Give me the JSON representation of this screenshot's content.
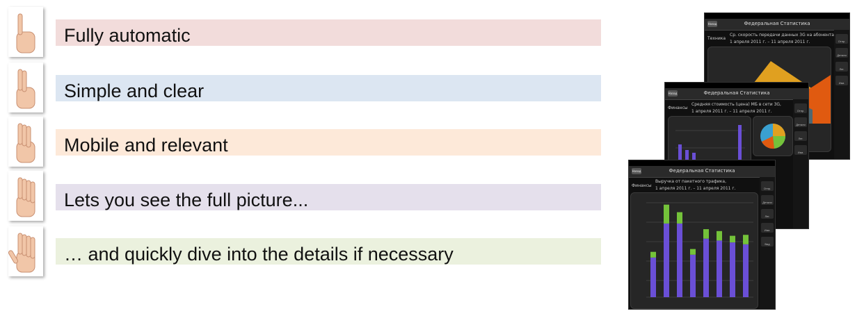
{
  "features": [
    {
      "label": "Fully automatic",
      "color": "#f2dcdb",
      "fingers": 1
    },
    {
      "label": "Simple and clear",
      "color": "#dce6f2",
      "fingers": 2
    },
    {
      "label": "Mobile and relevant",
      "color": "#fde9d9",
      "fingers": 3
    },
    {
      "label": "Lets you see the full picture...",
      "color": "#e5e0ec",
      "fingers": 4
    },
    {
      "label": "… and quickly dive into the details if necessary",
      "color": "#ebf1de",
      "fingers": 5
    }
  ],
  "screens": {
    "back": {
      "title": "Федеральная Статистика",
      "category": "Техника",
      "caption": "Ср. скорость передачи данных 3G на абонента,",
      "period": "1 апреля 2011 г. – 11 апреля 2011 г."
    },
    "middle": {
      "title": "Федеральная Статистика",
      "category": "Финансы",
      "caption": "Средняя стоимость (цена) МБ в сети 3G,",
      "period": "1 апреля 2011 г. – 11 апреля 2011 г."
    },
    "front": {
      "title": "Федеральная Статистика",
      "category": "Финансы",
      "caption": "Выручка от пакетного трафика,",
      "period": "1 апреля 2011 г. – 11 апреля 2011 г.",
      "bars": [
        {
          "purple": 0.42,
          "green": 0.06
        },
        {
          "purple": 0.78,
          "green": 0.2
        },
        {
          "purple": 0.78,
          "green": 0.12
        },
        {
          "purple": 0.45,
          "green": 0.06
        },
        {
          "purple": 0.62,
          "green": 0.1
        },
        {
          "purple": 0.6,
          "green": 0.1
        },
        {
          "purple": 0.58,
          "green": 0.07
        },
        {
          "purple": 0.56,
          "green": 0.1
        }
      ],
      "colors": {
        "purple": "#6a4fd6",
        "green": "#74c23a"
      }
    }
  },
  "side_buttons": [
    "Отправить",
    "Детали",
    "Легенда",
    "Изменить",
    "Вид"
  ]
}
